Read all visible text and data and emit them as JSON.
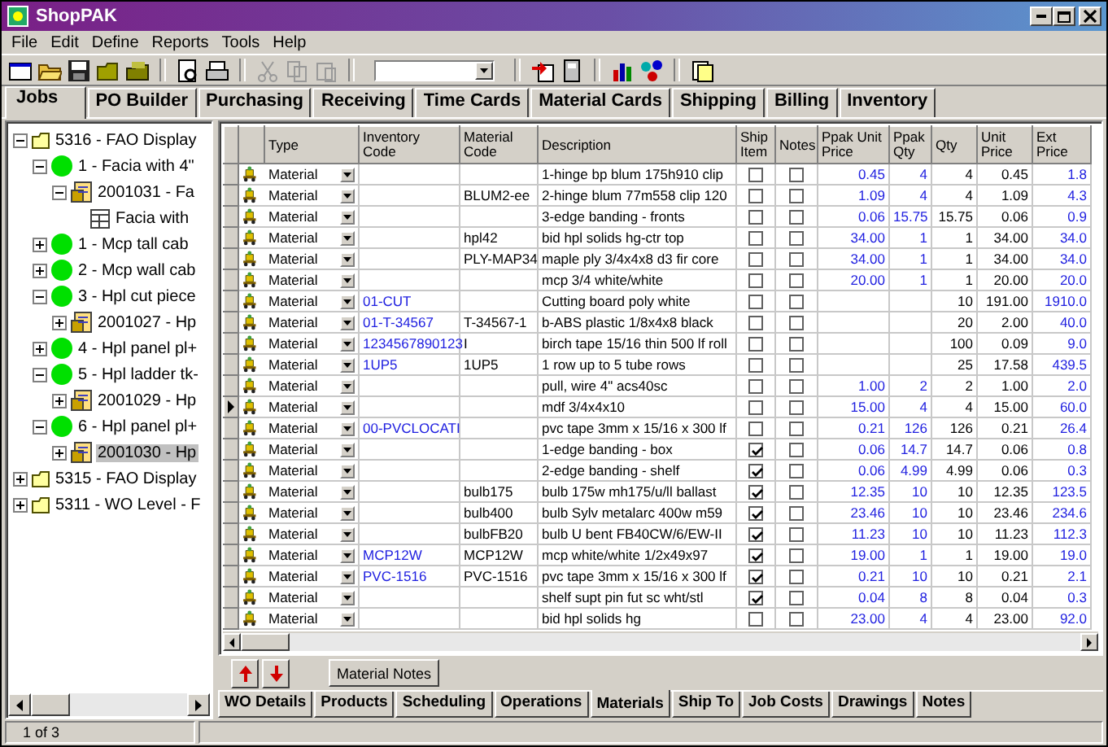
{
  "window": {
    "title": "ShopPAK"
  },
  "menu": [
    "File",
    "Edit",
    "Define",
    "Reports",
    "Tools",
    "Help"
  ],
  "tabs": [
    {
      "label": "Jobs",
      "selected": true
    },
    {
      "label": "PO Builder",
      "selected": false
    },
    {
      "label": "Purchasing",
      "selected": false
    },
    {
      "label": "Receiving",
      "selected": false
    },
    {
      "label": "Time Cards",
      "selected": false
    },
    {
      "label": "Material Cards",
      "selected": false
    },
    {
      "label": "Shipping",
      "selected": false
    },
    {
      "label": "Billing",
      "selected": false
    },
    {
      "label": "Inventory",
      "selected": false
    }
  ],
  "tree": [
    {
      "kind": "job",
      "label": "5316 - FAO Display",
      "expanded": true,
      "selected": false,
      "children": [
        {
          "kind": "item",
          "label": "1 - Facia with 4\"",
          "expanded": true,
          "selected": false,
          "children": [
            {
              "kind": "workorder",
              "label": "2001031 - Fa",
              "expanded": true,
              "selected": false,
              "children": [
                {
                  "kind": "part",
                  "label": "Facia with",
                  "selected": false
                }
              ]
            }
          ]
        },
        {
          "kind": "item",
          "label": "1 - Mcp tall cab",
          "expanded": false,
          "selected": false
        },
        {
          "kind": "item",
          "label": "2 - Mcp wall cab",
          "expanded": false,
          "selected": false
        },
        {
          "kind": "item",
          "label": "3 - Hpl cut piece",
          "expanded": true,
          "selected": false,
          "children": [
            {
              "kind": "workorder",
              "label": "2001027 - Hp",
              "expanded": false,
              "selected": false
            }
          ]
        },
        {
          "kind": "item",
          "label": "4 - Hpl panel pl+",
          "expanded": false,
          "selected": false
        },
        {
          "kind": "item",
          "label": "5 - Hpl ladder tk-",
          "expanded": true,
          "selected": false,
          "children": [
            {
              "kind": "workorder",
              "label": "2001029 - Hp",
              "expanded": false,
              "selected": false
            }
          ]
        },
        {
          "kind": "item",
          "label": "6 - Hpl panel pl+",
          "expanded": true,
          "selected": false,
          "children": [
            {
              "kind": "workorder",
              "label": "2001030 - Hp",
              "expanded": false,
              "selected": true
            }
          ]
        }
      ]
    },
    {
      "kind": "job",
      "label": "5315 - FAO Display",
      "expanded": false,
      "selected": false
    },
    {
      "kind": "job",
      "label": "5311 - WO Level - F",
      "expanded": false,
      "selected": false
    }
  ],
  "grid": {
    "columns": [
      "Type",
      "Inventory Code",
      "Material Code",
      "Description",
      "Ship Item",
      "Notes",
      "Ppak Unit Price",
      "Ppak Qty",
      "Qty",
      "Unit Price",
      "Ext Price"
    ],
    "rows": [
      {
        "type": "Material",
        "description": "1-hinge bp blum 175h910 clip",
        "ship_item": false,
        "notes": false,
        "ppak_unit_price": "0.45",
        "ppak_qty": "4",
        "qty": "4",
        "unit_price": "0.45",
        "ext_price": "1.8",
        "current": false
      },
      {
        "type": "Material",
        "material_code": "BLUM2-ee",
        "description": "2-hinge blum 77m558 clip 120",
        "ship_item": false,
        "notes": false,
        "ppak_unit_price": "1.09",
        "ppak_qty": "4",
        "qty": "4",
        "unit_price": "1.09",
        "ext_price": "4.3",
        "current": false
      },
      {
        "type": "Material",
        "description": "3-edge banding - fronts",
        "ship_item": false,
        "notes": false,
        "ppak_unit_price": "0.06",
        "ppak_qty": "15.75",
        "qty": "15.75",
        "unit_price": "0.06",
        "ext_price": "0.9",
        "current": false
      },
      {
        "type": "Material",
        "material_code": "hpl42",
        "description": "bid hpl solids hg-ctr top",
        "ship_item": false,
        "notes": false,
        "ppak_unit_price": "34.00",
        "ppak_qty": "1",
        "qty": "1",
        "unit_price": "34.00",
        "ext_price": "34.0",
        "current": false
      },
      {
        "type": "Material",
        "material_code": "PLY-MAP34",
        "description": "maple ply 3/4x4x8 d3 fir core",
        "ship_item": false,
        "notes": false,
        "ppak_unit_price": "34.00",
        "ppak_qty": "1",
        "qty": "1",
        "unit_price": "34.00",
        "ext_price": "34.0",
        "current": false
      },
      {
        "type": "Material",
        "description": "mcp 3/4 white/white",
        "ship_item": false,
        "notes": false,
        "ppak_unit_price": "20.00",
        "ppak_qty": "1",
        "qty": "1",
        "unit_price": "20.00",
        "ext_price": "20.0",
        "current": false
      },
      {
        "type": "Material",
        "inventory_code": "01-CUT",
        "description": "Cutting board poly white",
        "ship_item": false,
        "notes": false,
        "qty": "10",
        "unit_price": "191.00",
        "ext_price": "1910.0",
        "current": false
      },
      {
        "type": "Material",
        "inventory_code": "01-T-34567",
        "material_code": "T-34567-1",
        "description": "b-ABS plastic 1/8x4x8 black",
        "ship_item": false,
        "notes": false,
        "qty": "20",
        "unit_price": "2.00",
        "ext_price": "40.0",
        "current": false
      },
      {
        "type": "Material",
        "inventory_code": "1234567890123",
        "material_code": "I",
        "description": "birch tape 15/16 thin 500 lf roll",
        "ship_item": false,
        "notes": false,
        "qty": "100",
        "unit_price": "0.09",
        "ext_price": "9.0",
        "current": false
      },
      {
        "type": "Material",
        "inventory_code": "1UP5",
        "material_code": "1UP5",
        "description": "1 row up to 5 tube rows",
        "ship_item": false,
        "notes": false,
        "qty": "25",
        "unit_price": "17.58",
        "ext_price": "439.5",
        "current": false
      },
      {
        "type": "Material",
        "description": "pull, wire 4\" acs40sc",
        "ship_item": false,
        "notes": false,
        "ppak_unit_price": "1.00",
        "ppak_qty": "2",
        "qty": "2",
        "unit_price": "1.00",
        "ext_price": "2.0",
        "current": false
      },
      {
        "type": "Material",
        "description": "mdf 3/4x4x10",
        "ship_item": false,
        "notes": false,
        "ppak_unit_price": "15.00",
        "ppak_qty": "4",
        "qty": "4",
        "unit_price": "15.00",
        "ext_price": "60.0",
        "current": true
      },
      {
        "type": "Material",
        "inventory_code": "00-PVCLOCATI",
        "description": "pvc tape 3mm x 15/16 x 300 lf",
        "ship_item": false,
        "notes": false,
        "ppak_unit_price": "0.21",
        "ppak_qty": "126",
        "qty": "126",
        "unit_price": "0.21",
        "ext_price": "26.4",
        "current": false
      },
      {
        "type": "Material",
        "description": "1-edge banding - box",
        "ship_item": true,
        "notes": false,
        "ppak_unit_price": "0.06",
        "ppak_qty": "14.7",
        "qty": "14.7",
        "unit_price": "0.06",
        "ext_price": "0.8",
        "current": false
      },
      {
        "type": "Material",
        "description": "2-edge banding - shelf",
        "ship_item": true,
        "notes": false,
        "ppak_unit_price": "0.06",
        "ppak_qty": "4.99",
        "qty": "4.99",
        "unit_price": "0.06",
        "ext_price": "0.3",
        "current": false
      },
      {
        "type": "Material",
        "material_code": "bulb175",
        "description": "bulb 175w mh175/u/ll ballast",
        "ship_item": true,
        "notes": false,
        "ppak_unit_price": "12.35",
        "ppak_qty": "10",
        "qty": "10",
        "unit_price": "12.35",
        "ext_price": "123.5",
        "current": false
      },
      {
        "type": "Material",
        "material_code": "bulb400",
        "description": "bulb Sylv metalarc 400w m59",
        "ship_item": true,
        "notes": false,
        "ppak_unit_price": "23.46",
        "ppak_qty": "10",
        "qty": "10",
        "unit_price": "23.46",
        "ext_price": "234.6",
        "current": false
      },
      {
        "type": "Material",
        "material_code": "bulbFB20",
        "description": "bulb U bent FB40CW/6/EW-II",
        "ship_item": true,
        "notes": false,
        "ppak_unit_price": "11.23",
        "ppak_qty": "10",
        "qty": "10",
        "unit_price": "11.23",
        "ext_price": "112.3",
        "current": false
      },
      {
        "type": "Material",
        "inventory_code": "MCP12W",
        "material_code": "MCP12W",
        "description": "mcp white/white 1/2x49x97",
        "ship_item": true,
        "notes": false,
        "ppak_unit_price": "19.00",
        "ppak_qty": "1",
        "qty": "1",
        "unit_price": "19.00",
        "ext_price": "19.0",
        "current": false
      },
      {
        "type": "Material",
        "inventory_code": "PVC-1516",
        "material_code": "PVC-1516",
        "description": "pvc tape 3mm x 15/16 x 300 lf",
        "ship_item": true,
        "notes": false,
        "ppak_unit_price": "0.21",
        "ppak_qty": "10",
        "qty": "10",
        "unit_price": "0.21",
        "ext_price": "2.1",
        "current": false
      },
      {
        "type": "Material",
        "description": "shelf supt pin fut sc wht/stl",
        "ship_item": true,
        "notes": false,
        "ppak_unit_price": "0.04",
        "ppak_qty": "8",
        "qty": "8",
        "unit_price": "0.04",
        "ext_price": "0.3",
        "current": false
      },
      {
        "type": "Material",
        "description": "bid hpl solids hg",
        "ship_item": false,
        "notes": false,
        "ppak_unit_price": "23.00",
        "ppak_qty": "4",
        "qty": "4",
        "unit_price": "23.00",
        "ext_price": "92.0",
        "current": false
      }
    ]
  },
  "material_notes_button": "Material Notes",
  "bottom_tabs": [
    {
      "label": "WO Details",
      "selected": false
    },
    {
      "label": "Products",
      "selected": false
    },
    {
      "label": "Scheduling",
      "selected": false
    },
    {
      "label": "Operations",
      "selected": false
    },
    {
      "label": "Materials",
      "selected": true
    },
    {
      "label": "Ship To",
      "selected": false
    },
    {
      "label": "Job Costs",
      "selected": false
    },
    {
      "label": "Drawings",
      "selected": false
    },
    {
      "label": "Notes",
      "selected": false
    }
  ],
  "status_bar": {
    "record": "1 of 3"
  }
}
